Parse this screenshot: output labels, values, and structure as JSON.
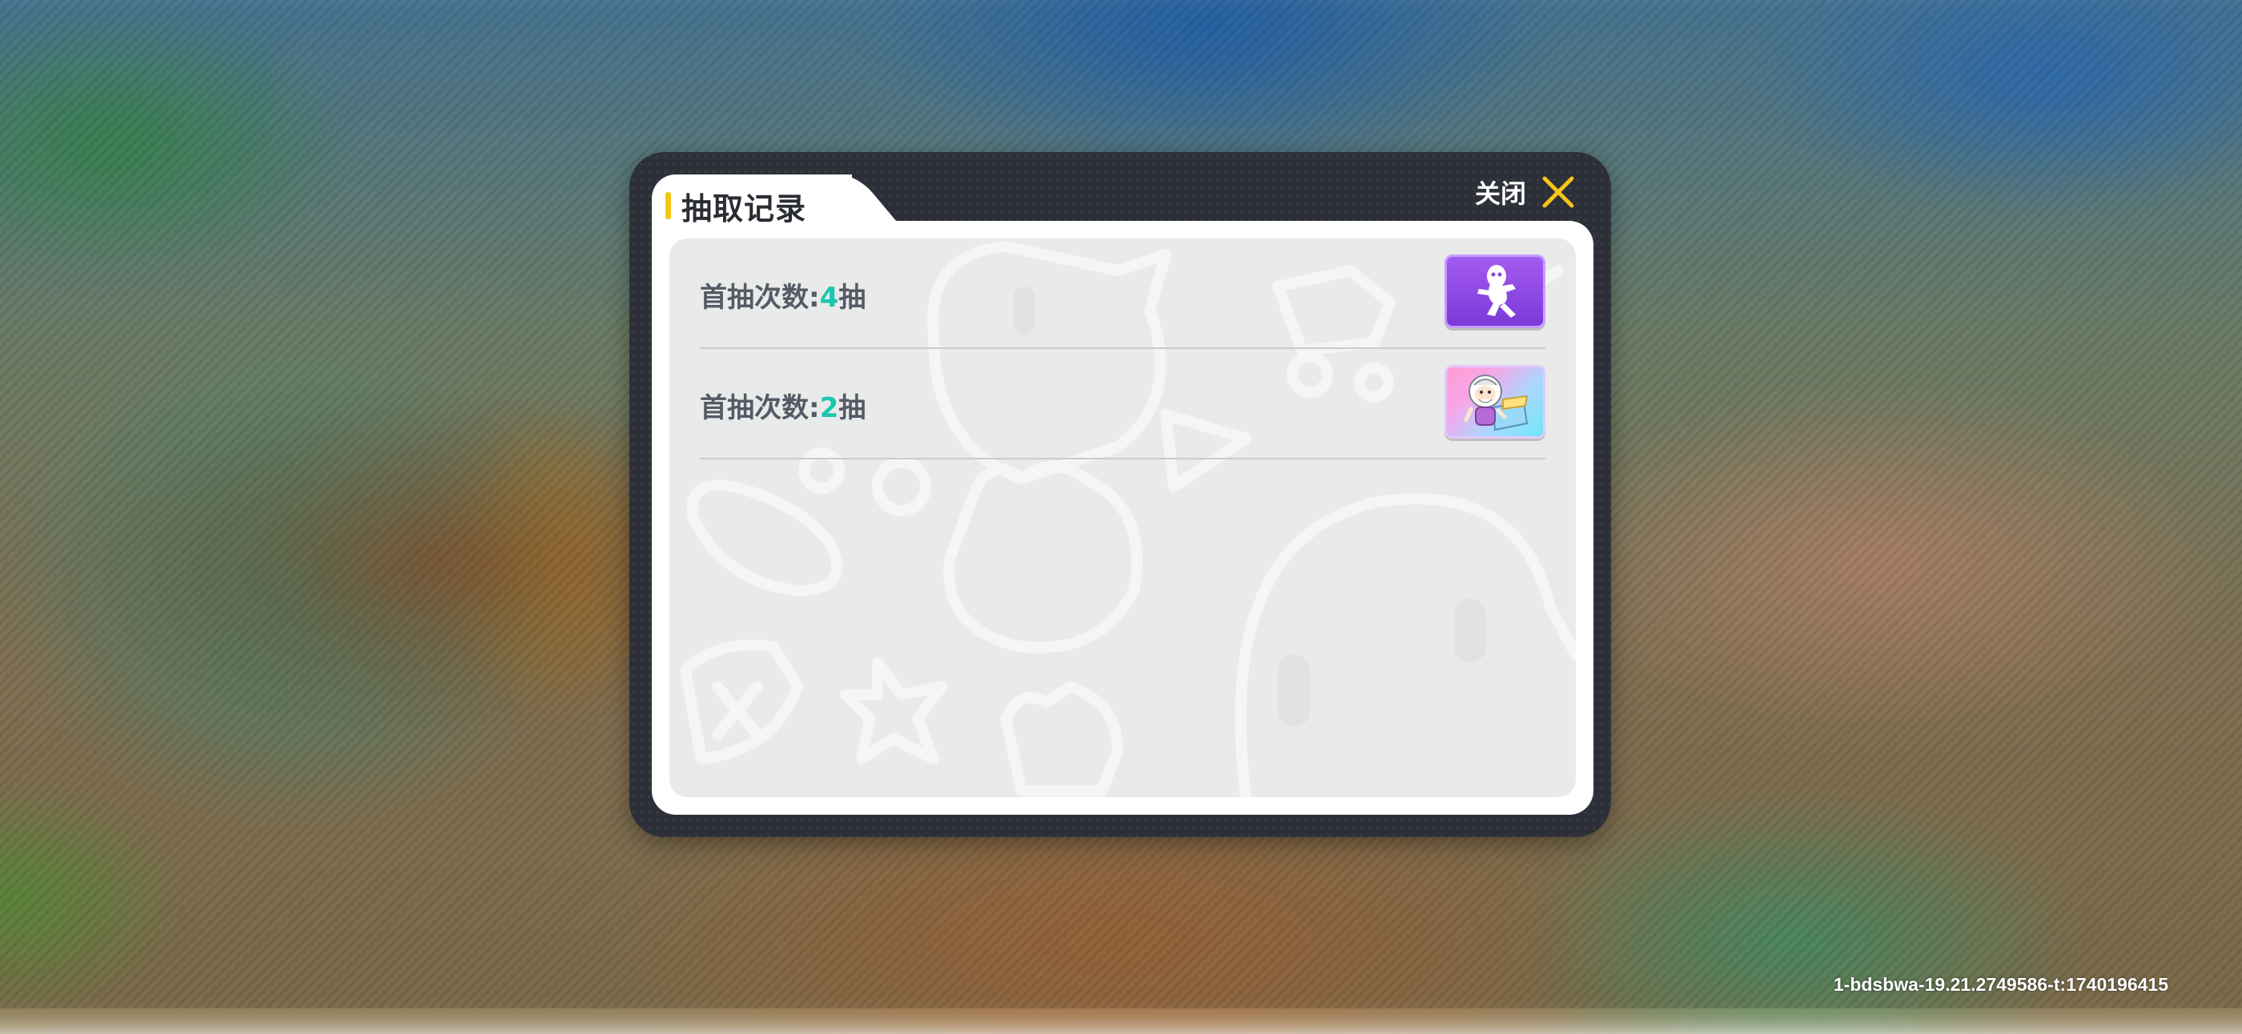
{
  "dialog": {
    "title": "抽取记录",
    "close_label": "关闭",
    "records": [
      {
        "prefix": "首抽次数:",
        "count": "4",
        "suffix": "抽",
        "reward_icon": "purple-character-card-icon"
      },
      {
        "prefix": "首抽次数:",
        "count": "2",
        "suffix": "抽",
        "reward_icon": "sheep-elder-character-card-icon"
      }
    ]
  },
  "build_info": "1-bdsbwa-19.21.2749586-t:1740196415",
  "colors": {
    "accent": "#f5c518",
    "count_highlight": "#19c7b0",
    "dialog_frame": "#2d3038",
    "list_bg": "#e9eaea"
  }
}
